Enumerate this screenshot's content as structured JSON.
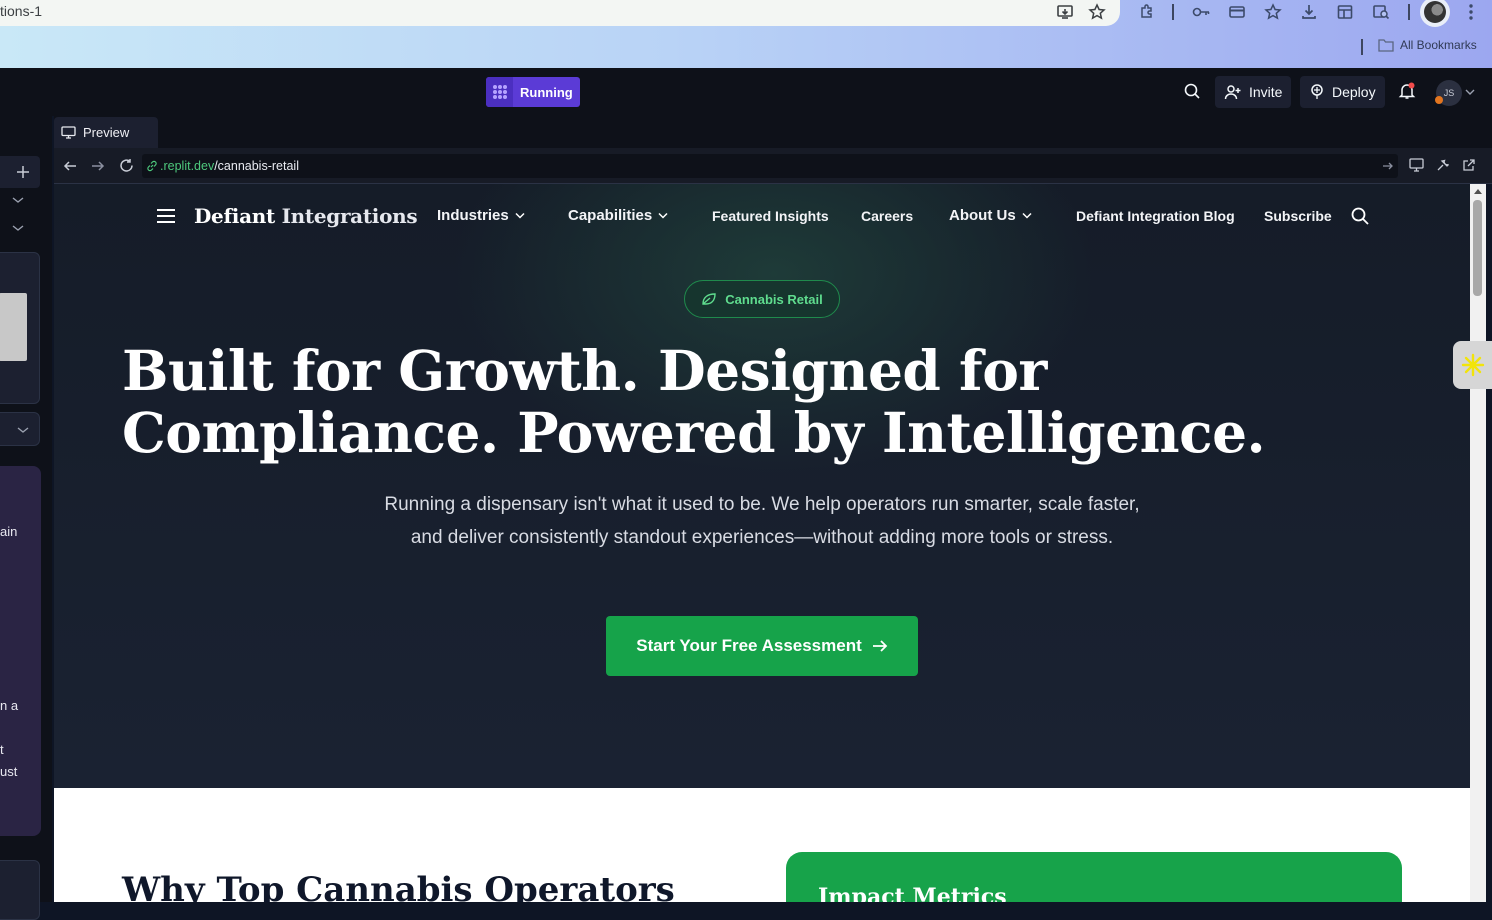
{
  "browser": {
    "tab_title_fragment": "tions-1",
    "bookmarks_label": "All Bookmarks"
  },
  "replit": {
    "status_label": "Running",
    "invite_label": "Invite",
    "deploy_label": "Deploy",
    "avatar_initials": "JS"
  },
  "left_panel": {
    "snippets": [
      "ain",
      "n a",
      "t",
      "ust"
    ]
  },
  "preview": {
    "tab_label": "Preview",
    "url_domain": ".replit.dev",
    "url_path": "/cannabis-retail"
  },
  "site": {
    "brand_bold": "Defiant",
    "brand_rest": "Integrations",
    "nav": {
      "industries": "Industries",
      "capabilities": "Capabilities",
      "featured_insights": "Featured Insights",
      "careers": "Careers",
      "about_us": "About Us",
      "blog": "Defiant Integration Blog",
      "subscribe": "Subscribe"
    },
    "badge_label": "Cannabis Retail",
    "headline_line1": "Built for Growth. Designed for",
    "headline_line2": "Compliance. Powered by Intelligence.",
    "subtext": "Running a dispensary isn't what it used to be. We help operators run smarter, scale faster, and deliver consistently standout experiences—without adding more tools or stress.",
    "cta_label": "Start Your Free Assessment",
    "why_heading": "Why Top Cannabis Operators",
    "impact_heading": "Impact Metrics"
  },
  "colors": {
    "accent_green": "#16a34a",
    "replit_purple": "#5b3bd6",
    "hero_bg": "#171e2b"
  }
}
